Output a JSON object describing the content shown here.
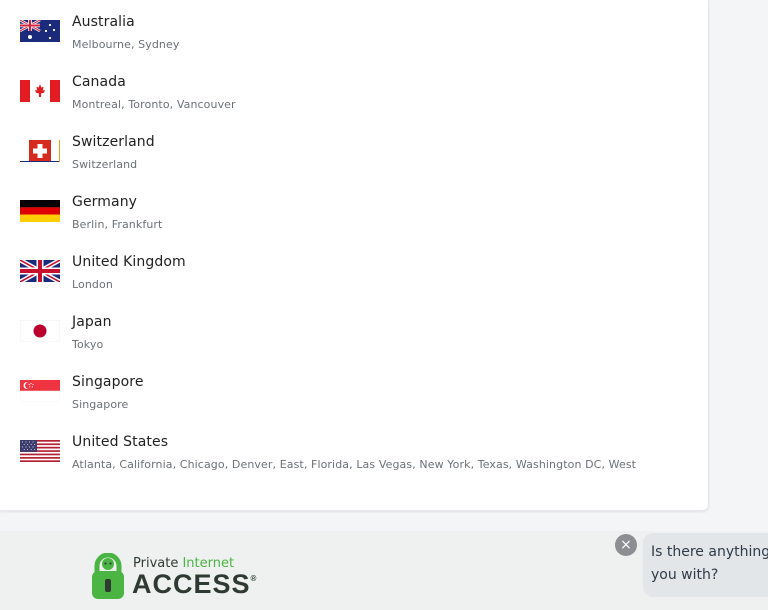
{
  "locations": [
    {
      "country": "Australia",
      "cities": "Melbourne, Sydney",
      "flag_icon": "flag-australia-icon"
    },
    {
      "country": "Canada",
      "cities": "Montreal, Toronto, Vancouver",
      "flag_icon": "flag-canada-icon"
    },
    {
      "country": "Switzerland",
      "cities": "Switzerland",
      "flag_icon": "flag-switzerland-icon"
    },
    {
      "country": "Germany",
      "cities": "Berlin, Frankfurt",
      "flag_icon": "flag-germany-icon"
    },
    {
      "country": "United Kingdom",
      "cities": "London",
      "flag_icon": "flag-uk-icon"
    },
    {
      "country": "Japan",
      "cities": "Tokyo",
      "flag_icon": "flag-japan-icon"
    },
    {
      "country": "Singapore",
      "cities": "Singapore",
      "flag_icon": "flag-singapore-icon"
    },
    {
      "country": "United States",
      "cities": "Atlanta, California, Chicago, Denver, East, Florida, Las Vegas, New York, Texas, Washington DC, West",
      "flag_icon": "flag-usa-icon"
    }
  ],
  "footer": {
    "logo_private": "Private",
    "logo_internet": "Internet",
    "logo_access": "ACCESS",
    "logo_reg": "®"
  },
  "chat": {
    "close_label": "×",
    "message_line1": "Is there anything",
    "message_line2": "you with?"
  },
  "colors": {
    "brand_green": "#4bb543",
    "logo_dark": "#2f3b32",
    "footer_bg": "#eef1ef"
  }
}
